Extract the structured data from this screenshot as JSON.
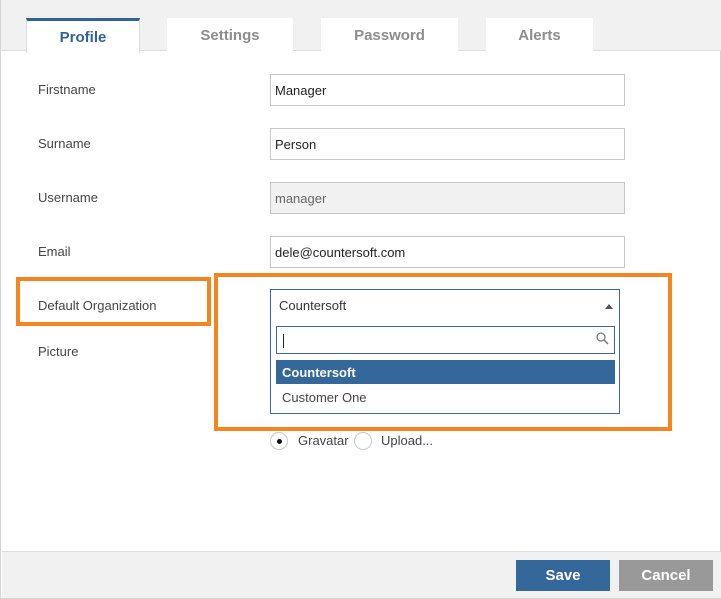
{
  "tabs": [
    {
      "label": "Profile",
      "active": true
    },
    {
      "label": "Settings",
      "active": false
    },
    {
      "label": "Password",
      "active": false
    },
    {
      "label": "Alerts",
      "active": false
    }
  ],
  "form": {
    "firstname_label": "Firstname",
    "firstname_value": "Manager",
    "surname_label": "Surname",
    "surname_value": "Person",
    "username_label": "Username",
    "username_value": "manager",
    "email_label": "Email",
    "email_value": "dele@countersoft.com",
    "organization_label": "Default Organization",
    "picture_label": "Picture"
  },
  "organization_select": {
    "selected": "Countersoft",
    "search_value": "",
    "options": [
      "Countersoft",
      "Customer One"
    ]
  },
  "picture_options": [
    {
      "label": "Gravatar",
      "checked": true
    },
    {
      "label": "Upload...",
      "checked": false
    }
  ],
  "footer": {
    "save_label": "Save",
    "cancel_label": "Cancel"
  },
  "colors": {
    "accent": "#34679a",
    "highlight": "#f5851f",
    "cancel": "#999999"
  },
  "icons": {
    "dropdown_caret": "chevron-up-icon",
    "search": "search-icon"
  }
}
